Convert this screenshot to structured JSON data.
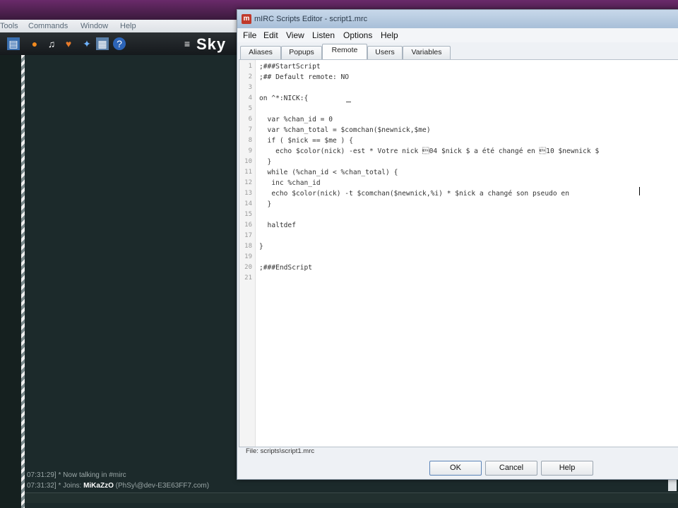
{
  "background_window": {
    "title": "",
    "menu": [
      "Tools",
      "Commands",
      "Window",
      "Help"
    ],
    "toolbar_icons": [
      "folder-icon",
      "firefox-icon",
      "music-note-icon",
      "bird-icon",
      "network-icon",
      "grid-icon",
      "help-icon",
      "menu-icon"
    ],
    "toolbar_logo": "Sky",
    "chat_lines": [
      {
        "time": "07:31:29]",
        "text": "* Now talking in #mirc"
      },
      {
        "time": "07:31:32]",
        "text": "* Joins: ",
        "nick": "MiKaZzO",
        "host": " (PhSy\\@dev-E3E63FF7.com)"
      }
    ]
  },
  "editor": {
    "title": "mIRC Scripts Editor - script1.mrc",
    "menu": [
      "File",
      "Edit",
      "View",
      "Listen",
      "Options",
      "Help"
    ],
    "tabs": [
      "Aliases",
      "Popups",
      "Remote",
      "Users",
      "Variables"
    ],
    "active_tab": "Remote",
    "code_lines": [
      ";###StartScript",
      ";## Default remote: NO",
      "",
      "on ^*:NICK:{",
      "",
      "  var %chan_id = 0",
      "  var %chan_total = $comchan($newnick,$me)",
      "  if ( $nick == $me ) {",
      "    echo $color(nick) -est * Votre nick \u000304 $nick $ a été changé en \u000310 $newnick $",
      "  }",
      "  while (%chan_id < %chan_total) {",
      "   inc %chan_id",
      "   echo $color(nick) -t $comchan($newnick,%i) * $nick a changé son pseudo en",
      "  }",
      "",
      "  haltdef",
      "",
      "}",
      "",
      ";###EndScript",
      ""
    ],
    "file_label": "File: scripts\\script1.mrc",
    "buttons": {
      "ok": "OK",
      "cancel": "Cancel",
      "help": "Help"
    }
  }
}
